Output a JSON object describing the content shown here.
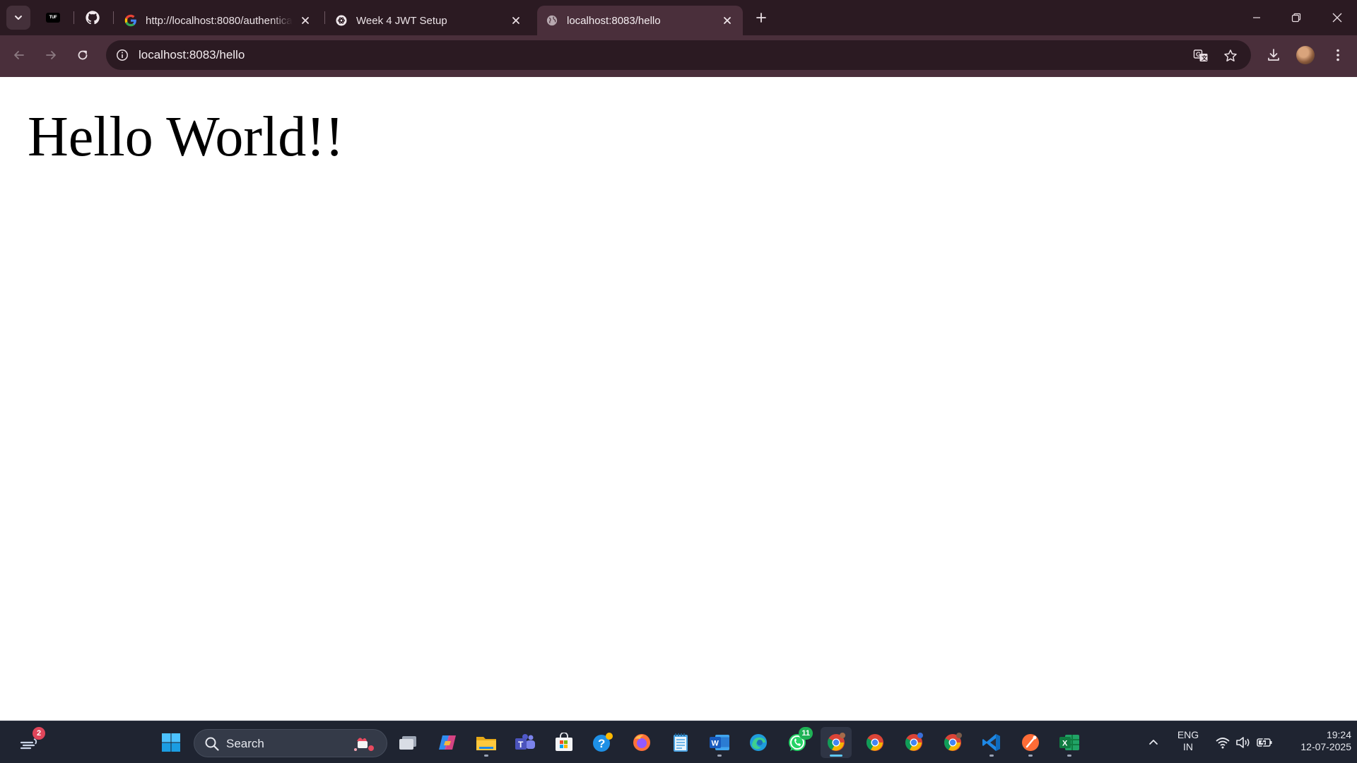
{
  "browser": {
    "tabs": [
      {
        "title": "http://localhost:8080/authenticate",
        "favicon": "google-icon",
        "active": false
      },
      {
        "title": "Week 4 JWT Setup",
        "favicon": "chatgpt-icon",
        "active": false
      },
      {
        "title": "localhost:8083/hello",
        "favicon": "globe-icon",
        "active": true
      }
    ],
    "pinned": [
      {
        "name": "tuf-logo",
        "text": "TUF"
      },
      {
        "name": "github-icon"
      }
    ],
    "address": "localhost:8083/hello",
    "colors": {
      "frame": "#2b1a22",
      "toolbar": "#4a2f3b"
    }
  },
  "page": {
    "heading": "Hello World!!"
  },
  "taskbar": {
    "search_label": "Search",
    "widgets_badge": "2",
    "whatsapp_badge": "11",
    "language_top": "ENG",
    "language_bottom": "IN",
    "time": "19:24",
    "date": "12-07-2025",
    "apps": [
      "start",
      "search",
      "task-view",
      "copilot",
      "file-explorer",
      "teams",
      "microsoft-store",
      "get-help",
      "firefox",
      "notepad",
      "word",
      "edge",
      "whatsapp",
      "chrome",
      "chrome-profile-2",
      "chrome-profile-3",
      "chrome-profile-4",
      "vscode",
      "postman",
      "excel"
    ]
  }
}
